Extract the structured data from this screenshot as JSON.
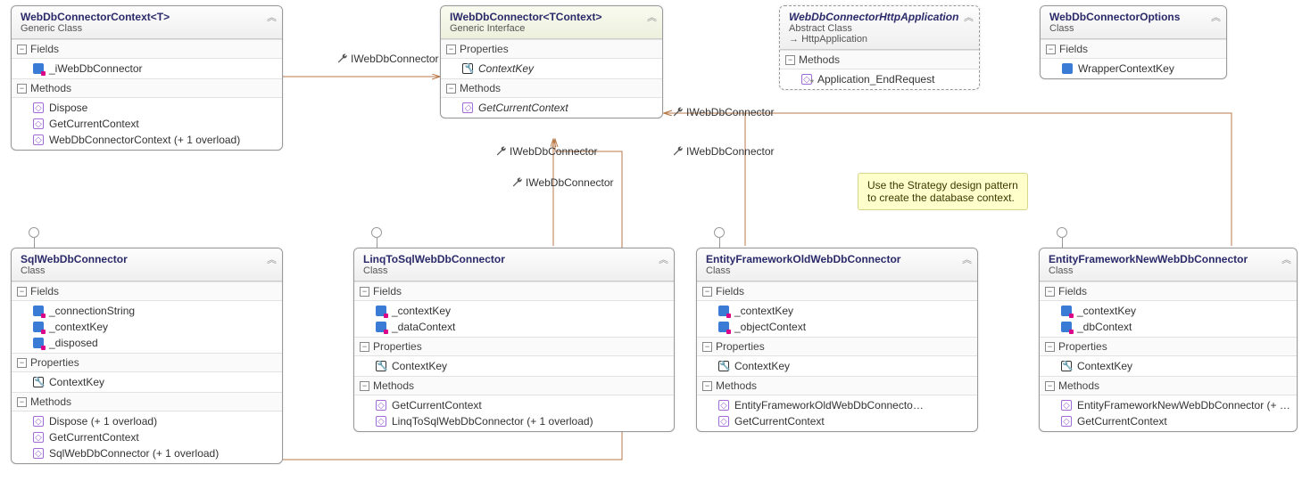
{
  "labels": {
    "fields": "Fields",
    "properties": "Properties",
    "methods": "Methods",
    "conn": "IWebDbConnector"
  },
  "note": {
    "line1": "Use the Strategy design pattern",
    "line2": "to create the database context."
  },
  "boxes": {
    "ctx": {
      "title": "WebDbConnectorContext<T>",
      "subtitle": "Generic Class",
      "fields": [
        "_iWebDbConnector"
      ],
      "methods": [
        "Dispose",
        "GetCurrentContext",
        "WebDbConnectorContext (+ 1 overload)"
      ]
    },
    "iface": {
      "title": "IWebDbConnector<TContext>",
      "subtitle": "Generic Interface",
      "properties": [
        "ContextKey"
      ],
      "methods": [
        "GetCurrentContext"
      ]
    },
    "httpapp": {
      "title": "WebDbConnectorHttpApplication",
      "subtitle": "Abstract Class",
      "arrow": "HttpApplication",
      "methods": [
        "Application_EndRequest"
      ]
    },
    "options": {
      "title": "WebDbConnectorOptions",
      "subtitle": "Class",
      "fields": [
        "WrapperContextKey"
      ]
    },
    "sql": {
      "title": "SqlWebDbConnector",
      "subtitle": "Class",
      "fields": [
        "_connectionString",
        "_contextKey",
        "_disposed"
      ],
      "properties": [
        "ContextKey"
      ],
      "methods": [
        "Dispose (+ 1 overload)",
        "GetCurrentContext",
        "SqlWebDbConnector (+ 1 overload)"
      ]
    },
    "linq": {
      "title": "LinqToSqlWebDbConnector",
      "subtitle": "Class",
      "fields": [
        "_contextKey",
        "_dataContext"
      ],
      "properties": [
        "ContextKey"
      ],
      "methods": [
        "GetCurrentContext",
        "LinqToSqlWebDbConnector (+ 1 overload)"
      ]
    },
    "efold": {
      "title": "EntityFrameworkOldWebDbConnector",
      "subtitle": "Class",
      "fields": [
        "_contextKey",
        "_objectContext"
      ],
      "properties": [
        "ContextKey"
      ],
      "methods": [
        "EntityFrameworkOldWebDbConnecto…",
        "GetCurrentContext"
      ]
    },
    "efnew": {
      "title": "EntityFrameworkNewWebDbConnector",
      "subtitle": "Class",
      "fields": [
        "_contextKey",
        "_dbContext"
      ],
      "properties": [
        "ContextKey"
      ],
      "methods": [
        "EntityFrameworkNewWebDbConnector  (+ …",
        "GetCurrentContext"
      ]
    }
  }
}
